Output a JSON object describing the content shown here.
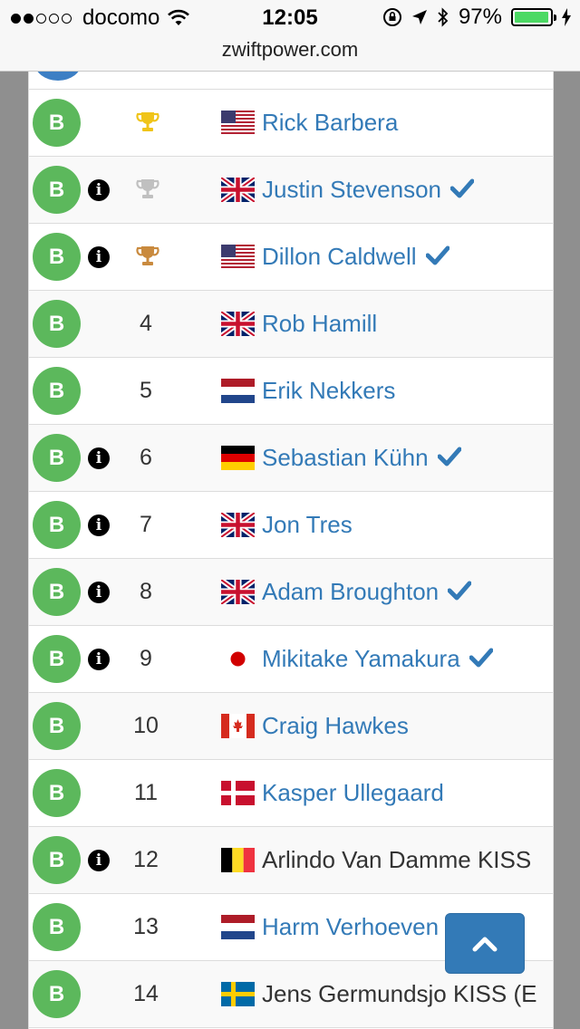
{
  "status": {
    "carrier": "docomo",
    "time": "12:05",
    "battery": "97%",
    "battery_level": 0.97
  },
  "browser": {
    "url": "zwiftpower.com"
  },
  "results": [
    {
      "category": "B",
      "info": false,
      "position": "",
      "trophy": "gold",
      "flag": "us",
      "name": "Rick Barbera",
      "verified": false,
      "linked": true
    },
    {
      "category": "B",
      "info": true,
      "position": "",
      "trophy": "silver",
      "flag": "gb",
      "name": "Justin Stevenson",
      "verified": true,
      "linked": true
    },
    {
      "category": "B",
      "info": true,
      "position": "",
      "trophy": "bronze",
      "flag": "us",
      "name": "Dillon Caldwell",
      "verified": true,
      "linked": true
    },
    {
      "category": "B",
      "info": false,
      "position": "4",
      "trophy": "",
      "flag": "gb",
      "name": "Rob Hamill",
      "verified": false,
      "linked": true
    },
    {
      "category": "B",
      "info": false,
      "position": "5",
      "trophy": "",
      "flag": "nl",
      "name": "Erik Nekkers",
      "verified": false,
      "linked": true
    },
    {
      "category": "B",
      "info": true,
      "position": "6",
      "trophy": "",
      "flag": "de",
      "name": "Sebastian Kühn",
      "verified": true,
      "linked": true
    },
    {
      "category": "B",
      "info": true,
      "position": "7",
      "trophy": "",
      "flag": "gb",
      "name": "Jon Tres",
      "verified": false,
      "linked": true
    },
    {
      "category": "B",
      "info": true,
      "position": "8",
      "trophy": "",
      "flag": "gb",
      "name": "Adam Broughton",
      "verified": true,
      "linked": true
    },
    {
      "category": "B",
      "info": true,
      "position": "9",
      "trophy": "",
      "flag": "jp",
      "name": "Mikitake Yamakura",
      "verified": true,
      "linked": true
    },
    {
      "category": "B",
      "info": false,
      "position": "10",
      "trophy": "",
      "flag": "ca",
      "name": "Craig Hawkes",
      "verified": false,
      "linked": true
    },
    {
      "category": "B",
      "info": false,
      "position": "11",
      "trophy": "",
      "flag": "dk",
      "name": "Kasper Ullegaard",
      "verified": false,
      "linked": true
    },
    {
      "category": "B",
      "info": true,
      "position": "12",
      "trophy": "",
      "flag": "be",
      "name": "Arlindo Van Damme KISS",
      "verified": false,
      "linked": false
    },
    {
      "category": "B",
      "info": false,
      "position": "13",
      "trophy": "",
      "flag": "nl",
      "name": "Harm Verhoeven",
      "verified": false,
      "linked": true
    },
    {
      "category": "B",
      "info": false,
      "position": "14",
      "trophy": "",
      "flag": "se",
      "name": "Jens Germundsjo KISS (E",
      "verified": false,
      "linked": false
    }
  ],
  "colors": {
    "category_b": "#5cb85c",
    "link": "#337ab7",
    "gold": "#f0c419",
    "silver": "#c0c0c0",
    "bronze": "#c98a3e",
    "verified": "#337ab7"
  }
}
